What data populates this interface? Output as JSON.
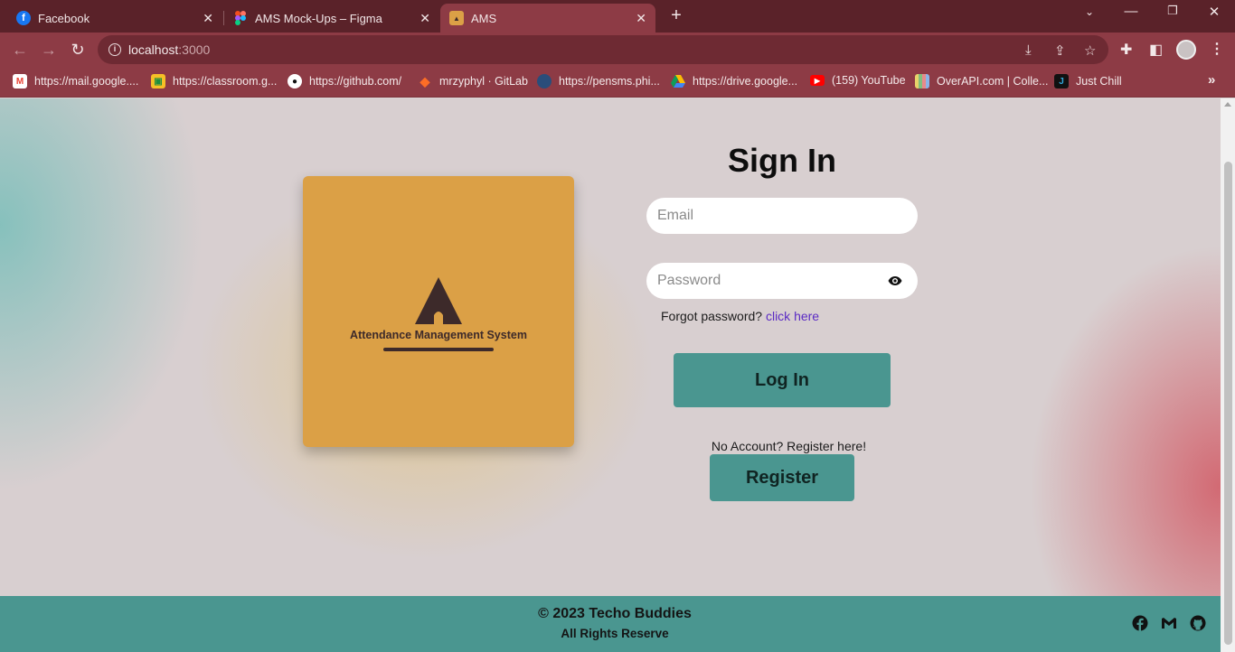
{
  "browser": {
    "tabs": [
      {
        "title": "Facebook",
        "icon": "facebook-icon"
      },
      {
        "title": "AMS Mock-Ups – Figma",
        "icon": "figma-icon"
      },
      {
        "title": "AMS",
        "icon": "ams-favicon",
        "active": true
      }
    ],
    "url_host": "localhost",
    "url_port": ":3000",
    "bookmarks": [
      {
        "label": "https://mail.google....",
        "icon": "gmail-icon"
      },
      {
        "label": "https://classroom.g...",
        "icon": "classroom-icon"
      },
      {
        "label": "https://github.com/",
        "icon": "github-icon"
      },
      {
        "label": "mrzyphyl · GitLab",
        "icon": "gitlab-icon"
      },
      {
        "label": "https://pensms.phi...",
        "icon": "pensms-icon"
      },
      {
        "label": "https://drive.google...",
        "icon": "drive-icon"
      },
      {
        "label": "(159) YouTube",
        "icon": "youtube-icon"
      },
      {
        "label": "OverAPI.com | Colle...",
        "icon": "overapi-icon"
      },
      {
        "label": "Just Chill",
        "icon": "justchill-icon"
      }
    ]
  },
  "logo": {
    "text": "Attendance Management System"
  },
  "signin": {
    "title": "Sign In",
    "email_placeholder": "Email",
    "password_placeholder": "Password",
    "forgot_text": "Forgot password?",
    "forgot_link": "click here",
    "login_label": "Log In",
    "no_account_text": "No Account? Register here!",
    "register_label": "Register"
  },
  "footer": {
    "copyright": "© 2023 Techo Buddies",
    "rights": "All Rights Reserve"
  },
  "colors": {
    "tabbar": "#5a2229",
    "toolbar": "#8d3b45",
    "logo_card": "#dba046",
    "button": "#4a9690",
    "footer": "#4a9690",
    "link": "#5b2bc4"
  }
}
